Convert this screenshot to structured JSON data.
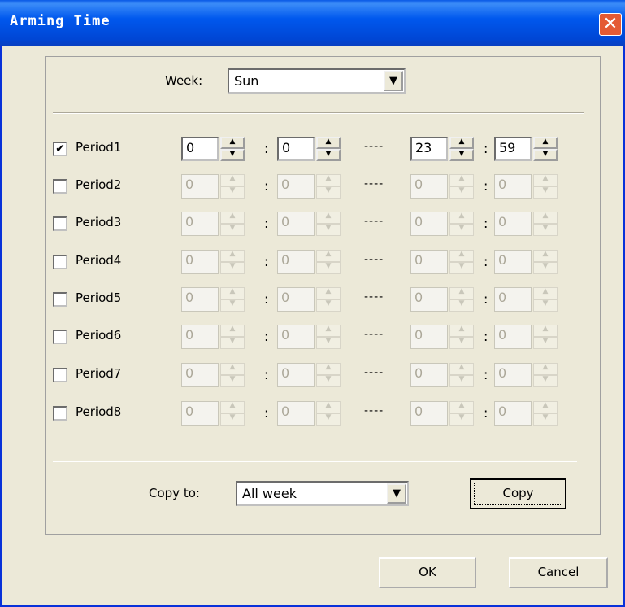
{
  "window": {
    "title": "Arming Time",
    "close_glyph": "✕"
  },
  "week": {
    "label": "Week:",
    "value": "Sun"
  },
  "periods": [
    {
      "label": "Period1",
      "checked": true,
      "start_h": "0",
      "start_m": "0",
      "end_h": "23",
      "end_m": "59"
    },
    {
      "label": "Period2",
      "checked": false,
      "start_h": "0",
      "start_m": "0",
      "end_h": "0",
      "end_m": "0"
    },
    {
      "label": "Period3",
      "checked": false,
      "start_h": "0",
      "start_m": "0",
      "end_h": "0",
      "end_m": "0"
    },
    {
      "label": "Period4",
      "checked": false,
      "start_h": "0",
      "start_m": "0",
      "end_h": "0",
      "end_m": "0"
    },
    {
      "label": "Period5",
      "checked": false,
      "start_h": "0",
      "start_m": "0",
      "end_h": "0",
      "end_m": "0"
    },
    {
      "label": "Period6",
      "checked": false,
      "start_h": "0",
      "start_m": "0",
      "end_h": "0",
      "end_m": "0"
    },
    {
      "label": "Period7",
      "checked": false,
      "start_h": "0",
      "start_m": "0",
      "end_h": "0",
      "end_m": "0"
    },
    {
      "label": "Period8",
      "checked": false,
      "start_h": "0",
      "start_m": "0",
      "end_h": "0",
      "end_m": "0"
    }
  ],
  "separator_colon": ":",
  "range_dash": "----",
  "copy": {
    "label": "Copy to:",
    "value": "All week",
    "button": "Copy"
  },
  "buttons": {
    "ok": "OK",
    "cancel": "Cancel"
  },
  "glyphs": {
    "dropdown": "▼",
    "spin_up": "▲",
    "spin_down": "▼",
    "check": "✔"
  },
  "colors": {
    "titlebar": "#0058ee",
    "close": "#e45a34",
    "dialog_bg": "#ece9d8"
  }
}
